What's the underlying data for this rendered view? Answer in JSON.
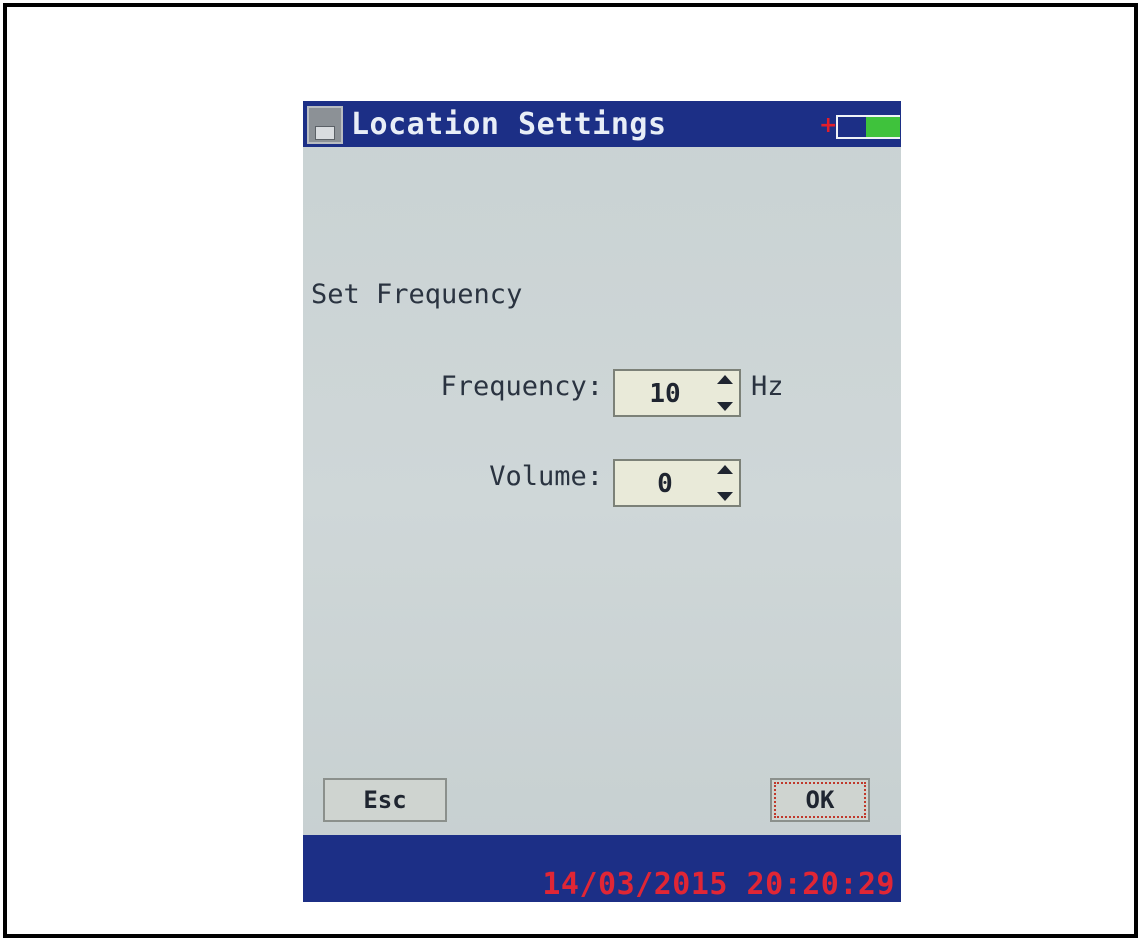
{
  "window": {
    "title": "Location Settings",
    "plug_glyph": "+",
    "battery_level": 0.55
  },
  "section": {
    "title": "Set Frequency"
  },
  "fields": {
    "frequency": {
      "label": "Frequency:",
      "value": "10",
      "unit": "Hz"
    },
    "volume": {
      "label": "Volume:",
      "value": "0"
    }
  },
  "buttons": {
    "esc_label": "Esc",
    "ok_label": "OK"
  },
  "status": {
    "datetime": "14/03/2015 20:20:29"
  },
  "colors": {
    "titlebar": "#1c2f86",
    "datetime": "#e02635",
    "battery": "#3fc23c"
  }
}
